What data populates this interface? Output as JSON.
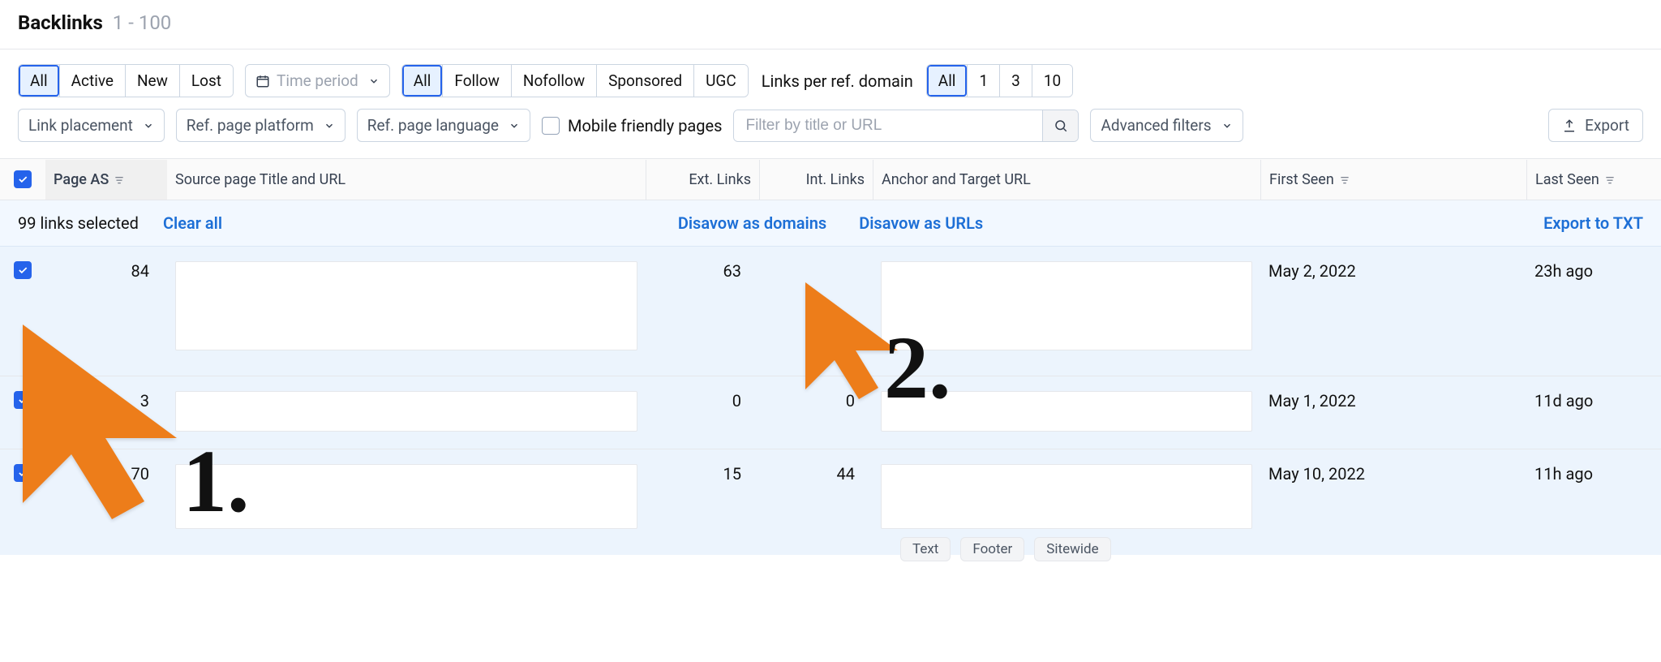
{
  "header": {
    "title": "Backlinks",
    "range": "1 - 100"
  },
  "filters": {
    "status": {
      "options": [
        "All",
        "Active",
        "New",
        "Lost"
      ],
      "active": "All"
    },
    "time_label": "Time period",
    "linktype": {
      "options": [
        "All",
        "Follow",
        "Nofollow",
        "Sponsored",
        "UGC"
      ],
      "active": "All"
    },
    "links_per_domain_label": "Links per ref. domain",
    "links_per_domain": {
      "options": [
        "All",
        "1",
        "3",
        "10"
      ],
      "active": "All"
    },
    "link_placement": "Link placement",
    "ref_platform": "Ref. page platform",
    "ref_language": "Ref. page language",
    "mobile_friendly": "Mobile friendly pages",
    "search_placeholder": "Filter by title or URL",
    "advanced_filters": "Advanced filters",
    "export": "Export"
  },
  "columns": {
    "page_as": "Page AS",
    "source": "Source page Title and URL",
    "ext": "Ext. Links",
    "int": "Int. Links",
    "anchor": "Anchor and Target URL",
    "first_seen": "First Seen",
    "last_seen": "Last Seen"
  },
  "selection_bar": {
    "count_text": "99 links selected",
    "clear": "Clear all",
    "disavow_domains": "Disavow as domains",
    "disavow_urls": "Disavow as URLs",
    "export_txt": "Export to TXT"
  },
  "rows": [
    {
      "page_as": "84",
      "ext": "63",
      "int": "",
      "first_seen": "May 2, 2022",
      "last_seen": "23h ago"
    },
    {
      "page_as": "3",
      "ext": "0",
      "int": "0",
      "first_seen": "May 1, 2022",
      "last_seen": "11d ago"
    },
    {
      "page_as": "70",
      "ext": "15",
      "int": "44",
      "first_seen": "May 10, 2022",
      "last_seen": "11h ago"
    }
  ],
  "chips": [
    "Text",
    "Footer",
    "Sitewide"
  ],
  "annotations": {
    "num1": "1.",
    "num2": "2."
  }
}
